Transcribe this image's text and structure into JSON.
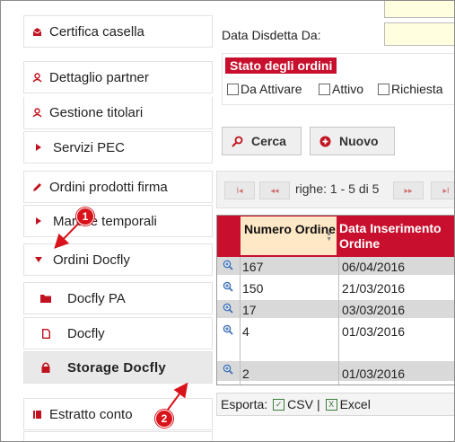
{
  "sidebar": {
    "items": [
      {
        "label": "Certifica casella"
      },
      {
        "label": "Dettaglio partner"
      },
      {
        "label": "Gestione titolari"
      },
      {
        "label": "Servizi PEC"
      },
      {
        "label": "Ordini prodotti firma"
      },
      {
        "label": "Marche temporali"
      },
      {
        "label": "Ordini Docfly"
      },
      {
        "label": "Docfly PA"
      },
      {
        "label": "Docfly"
      },
      {
        "label": "Storage  Docfly"
      },
      {
        "label": "Estratto conto"
      }
    ]
  },
  "filters": {
    "disdetta_label": "Data Disdetta Da:",
    "disdetta_value": "",
    "state_legend": "Stato degli ordini",
    "checkboxes": [
      {
        "label": "Da Attivare",
        "checked": false
      },
      {
        "label": "Attivo",
        "checked": false
      },
      {
        "label": "Richiesta",
        "checked": false
      }
    ]
  },
  "buttons": {
    "search": "Cerca",
    "new": "Nuovo"
  },
  "pager": {
    "text": "righe: 1 - 5 di 5"
  },
  "table": {
    "headers": [
      "Numero Ordine",
      "Data Inserimento Ordine"
    ],
    "rows": [
      {
        "numero": "167",
        "data": "06/04/2016"
      },
      {
        "numero": "150",
        "data": "21/03/2016"
      },
      {
        "numero": "17",
        "data": "03/03/2016"
      },
      {
        "numero": "4",
        "data": "01/03/2016"
      },
      {
        "numero": "2",
        "data": "01/03/2016"
      }
    ]
  },
  "export": {
    "label": "Esporta:",
    "csv": "CSV",
    "sep": "|",
    "excel": "Excel"
  },
  "annotations": {
    "one": "1",
    "two": "2"
  },
  "colors": {
    "accent": "#c8102e",
    "annotation": "#d8131b",
    "header_sorted": "#ffe8c6",
    "row_alt": "#d9d9d9",
    "input_bg": "#ffffe0"
  }
}
